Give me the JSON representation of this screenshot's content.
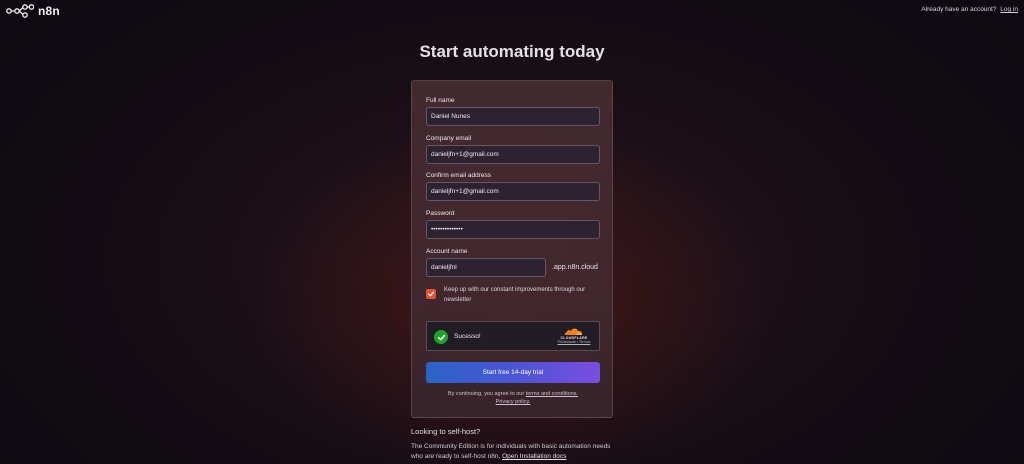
{
  "brand": {
    "name": "n8n"
  },
  "header": {
    "prompt": "Already have an account?",
    "login_link": "Log in"
  },
  "page": {
    "title": "Start automating today"
  },
  "form": {
    "full_name": {
      "label": "Full name",
      "value": "Daniel Nunes"
    },
    "company_email": {
      "label": "Company email",
      "value": "danieljfn+1@gmail.com"
    },
    "confirm_email": {
      "label": "Confirm email address",
      "value": "danieljfn+1@gmail.com"
    },
    "password": {
      "label": "Password",
      "value": "••••••••••••••"
    },
    "account_name": {
      "label": "Account name",
      "value": "danieljfnl",
      "suffix": ".app.n8n.cloud"
    },
    "newsletter": {
      "checked": true,
      "label": "Keep up with our constant improvements through our newsletter"
    },
    "captcha": {
      "status": "Sucesso!",
      "brand": "CLOUDFLARE",
      "links": "Privacidade • Termos"
    },
    "submit_label": "Start free 14-day trial",
    "legal": {
      "prefix": "By continuing, you agree to our",
      "terms_link": "terms and conditions.",
      "privacy_link": "Privacy policy."
    }
  },
  "selfhost": {
    "title": "Looking to self-host?",
    "body": "The Community Edition is for individuals with basic automation needs who are ready to self-host n8n.",
    "link": "Open Installation docs"
  },
  "colors": {
    "accent": "#e5522f",
    "captcha_success": "#1fa22a",
    "cta_start": "#2b63c6",
    "cta_end": "#7a4ee0"
  }
}
